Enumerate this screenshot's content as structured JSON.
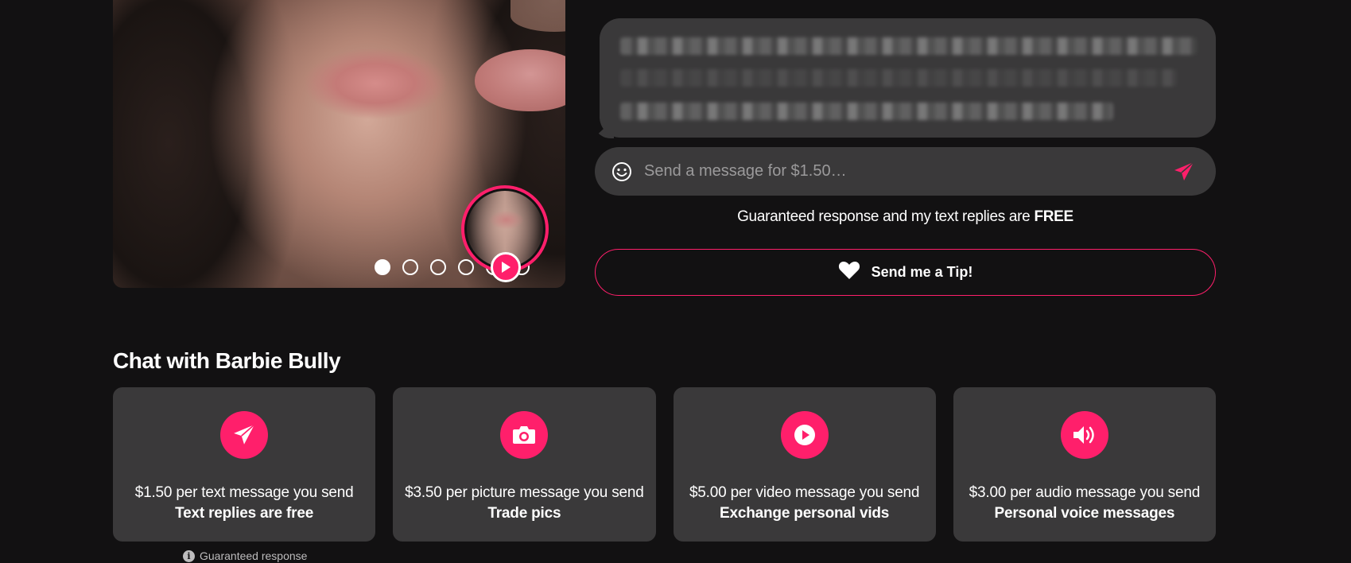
{
  "gallery": {
    "slide_count": 6,
    "active_index": 0
  },
  "composer": {
    "placeholder": "Send a message for $1.50…",
    "guarantee_text": "Guaranteed response and my text replies are ",
    "guarantee_emphasis": "FREE",
    "tip_label": "Send me a Tip!"
  },
  "chat": {
    "title": "Chat with Barbie Bully",
    "cards": [
      {
        "icon": "paper-plane-icon",
        "price": "$1.50 per text message you send",
        "perk": "Text replies are free"
      },
      {
        "icon": "camera-icon",
        "price": "$3.50 per picture message you send",
        "perk": "Trade pics"
      },
      {
        "icon": "play-icon",
        "price": "$5.00 per video message you send",
        "perk": "Exchange personal vids"
      },
      {
        "icon": "speaker-icon",
        "price": "$3.00 per audio message you send",
        "perk": "Personal voice messages"
      }
    ],
    "footnote": "Guaranteed response"
  },
  "colors": {
    "background": "#121112",
    "surface": "#3a393a",
    "accent": "#ff1f6b"
  }
}
